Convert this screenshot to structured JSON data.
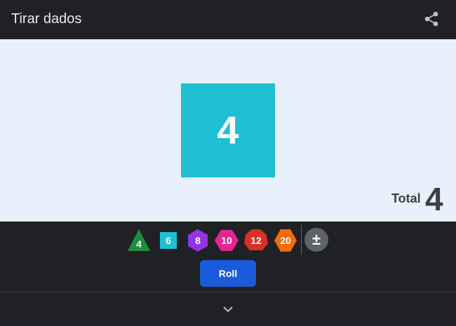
{
  "header": {
    "title": "Tirar dados",
    "share_icon": "share-icon"
  },
  "result": {
    "die_value": "4",
    "die_color": "#1fbfd4",
    "total_label": "Total",
    "total_value": "4"
  },
  "dice": [
    {
      "sides": "4",
      "shape": "triangle",
      "color": "#1e8e3e"
    },
    {
      "sides": "6",
      "shape": "square",
      "color": "#1fbfd4"
    },
    {
      "sides": "8",
      "shape": "hexagon",
      "color": "#9334e6"
    },
    {
      "sides": "10",
      "shape": "diamond",
      "color": "#e52592"
    },
    {
      "sides": "12",
      "shape": "polygon",
      "color": "#d93025"
    },
    {
      "sides": "20",
      "shape": "hexagon",
      "color": "#f06d0c"
    }
  ],
  "modifier": {
    "label": "±"
  },
  "actions": {
    "roll_label": "Roll",
    "expand_icon": "chevron-down-icon"
  }
}
